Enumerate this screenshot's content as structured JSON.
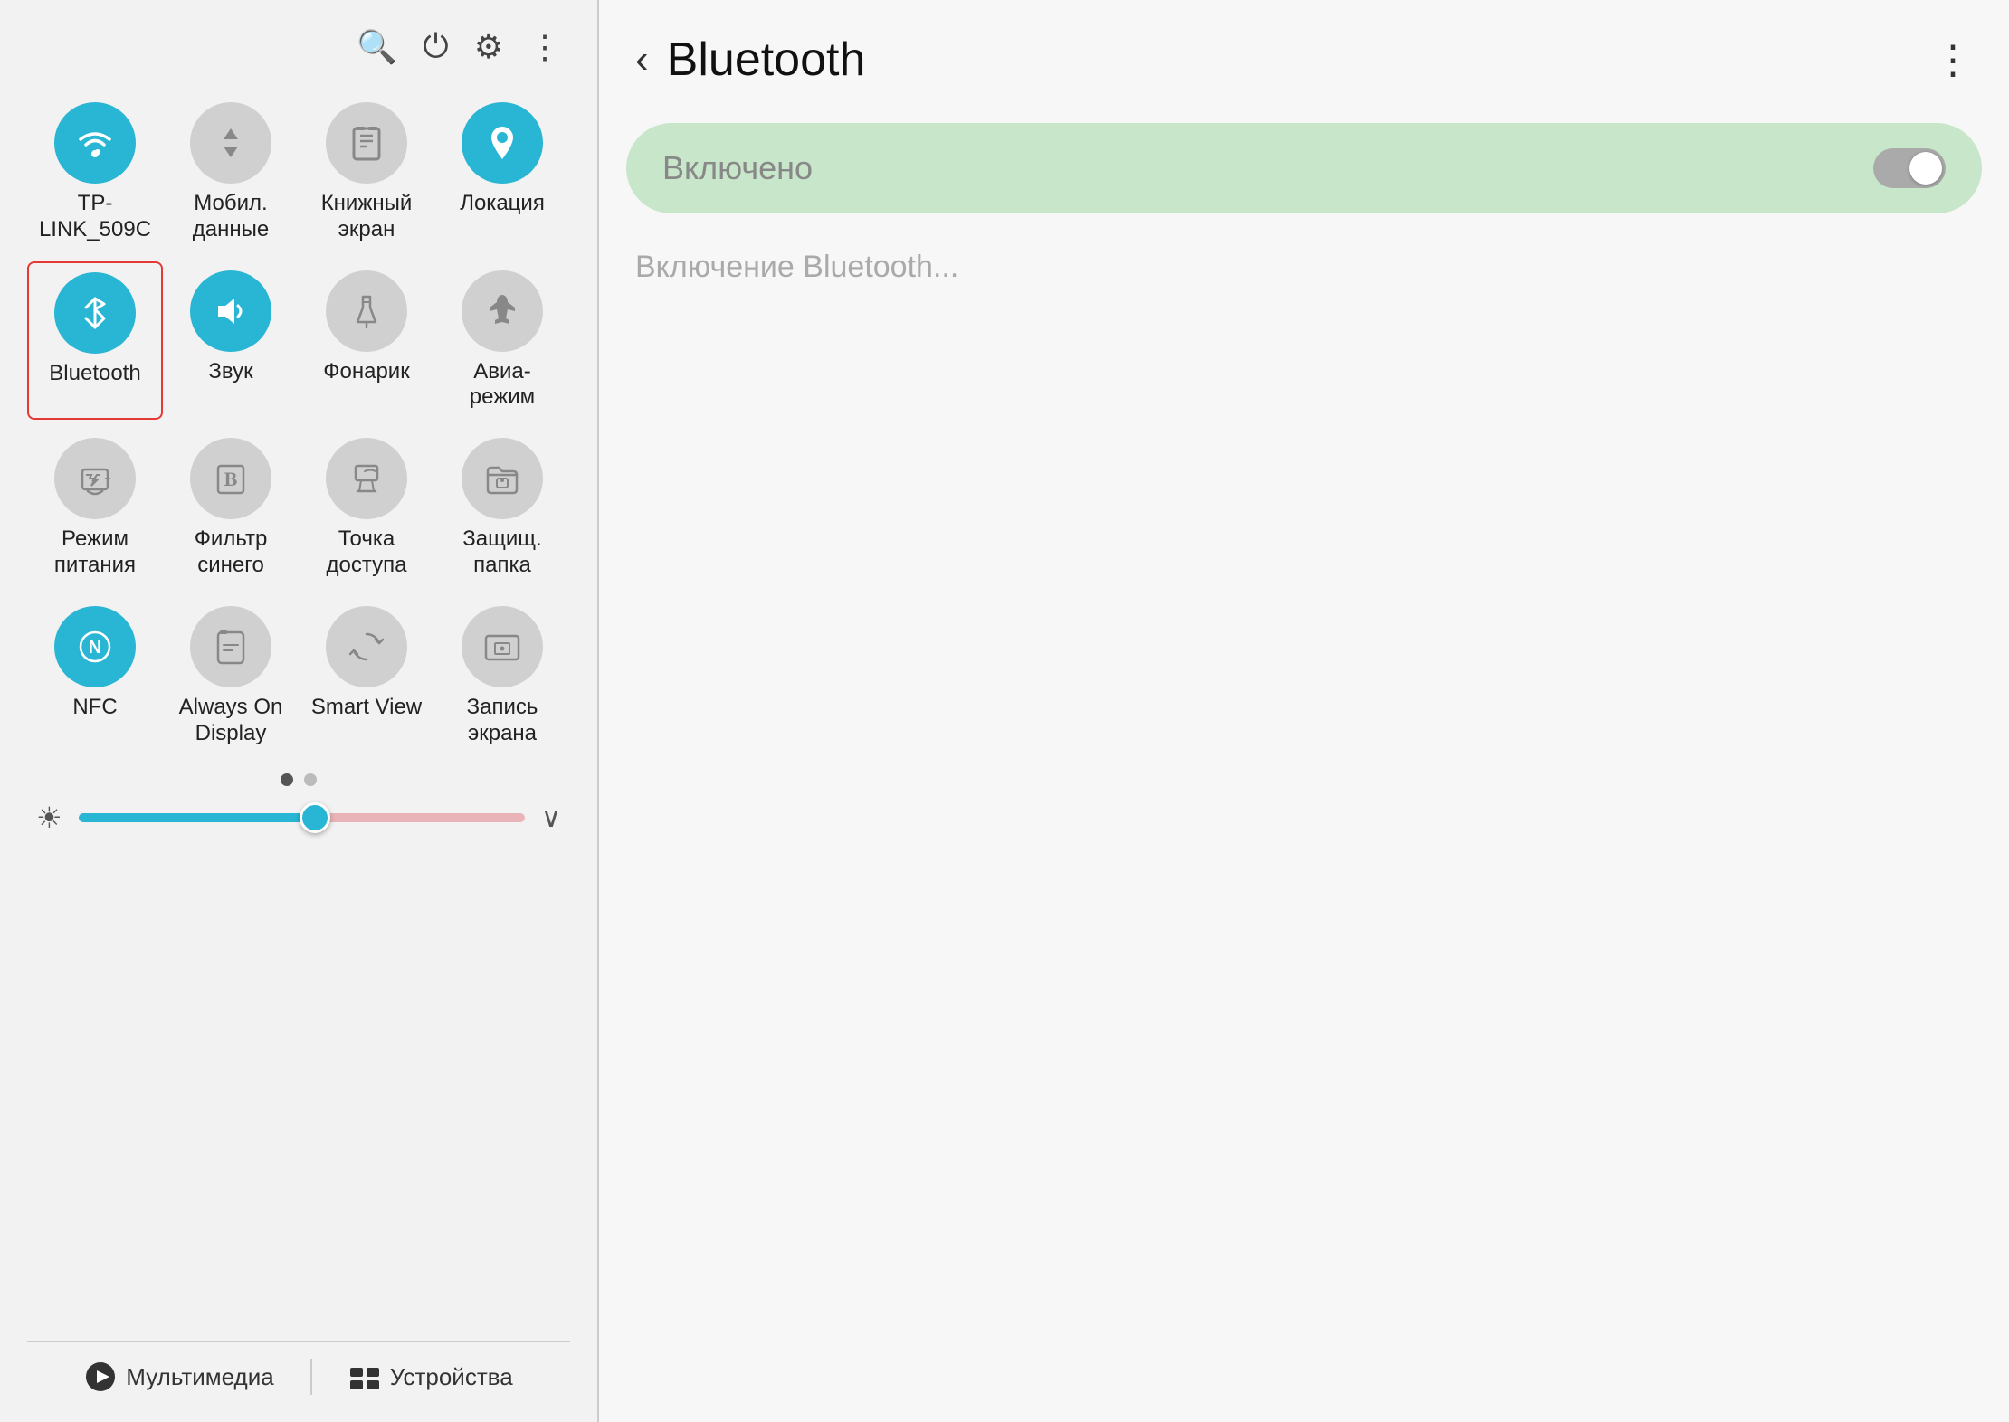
{
  "left": {
    "toolbar": {
      "search_icon": "🔍",
      "power_icon": "⏻",
      "settings_icon": "⚙",
      "more_icon": "⋮"
    },
    "quick_settings": [
      {
        "id": "wifi",
        "label": "TP-LINK_509C",
        "active": true,
        "icon": "wifi"
      },
      {
        "id": "data",
        "label": "Мобил.\nданные",
        "active": false,
        "icon": "data"
      },
      {
        "id": "book",
        "label": "Книжный\nэкран",
        "active": false,
        "icon": "book"
      },
      {
        "id": "location",
        "label": "Локация",
        "active": true,
        "icon": "location"
      },
      {
        "id": "bluetooth",
        "label": "Bluetooth",
        "active": true,
        "icon": "bluetooth",
        "selected": true
      },
      {
        "id": "sound",
        "label": "Звук",
        "active": true,
        "icon": "sound"
      },
      {
        "id": "flashlight",
        "label": "Фонарик",
        "active": false,
        "icon": "flashlight"
      },
      {
        "id": "airplane",
        "label": "Авиа-\nрежим",
        "active": false,
        "icon": "airplane"
      },
      {
        "id": "battery",
        "label": "Режим\nпитания",
        "active": false,
        "icon": "battery"
      },
      {
        "id": "bluefilter",
        "label": "Фильтр\nсинего",
        "active": false,
        "icon": "filter"
      },
      {
        "id": "hotspot",
        "label": "Точка\nдоступа",
        "active": false,
        "icon": "hotspot"
      },
      {
        "id": "securefolder",
        "label": "Защищ.\nпапка",
        "active": false,
        "icon": "folder"
      },
      {
        "id": "nfc",
        "label": "NFC",
        "active": true,
        "icon": "nfc"
      },
      {
        "id": "aod",
        "label": "Always On\nDisplay",
        "active": false,
        "icon": "aod"
      },
      {
        "id": "smartview",
        "label": "Smart View",
        "active": false,
        "icon": "smartview"
      },
      {
        "id": "screenrecord",
        "label": "Запись\nэкрана",
        "active": false,
        "icon": "screenrecord"
      }
    ],
    "brightness": {
      "value": 55
    },
    "bottom_bar": {
      "media_label": "Мультимедиа",
      "devices_label": "Устройства"
    }
  },
  "right": {
    "header": {
      "back_label": "‹",
      "title": "Bluetooth",
      "more_label": "⋮"
    },
    "toggle": {
      "label": "Включено",
      "enabled": true
    },
    "status_text": "Включение Bluetooth..."
  }
}
